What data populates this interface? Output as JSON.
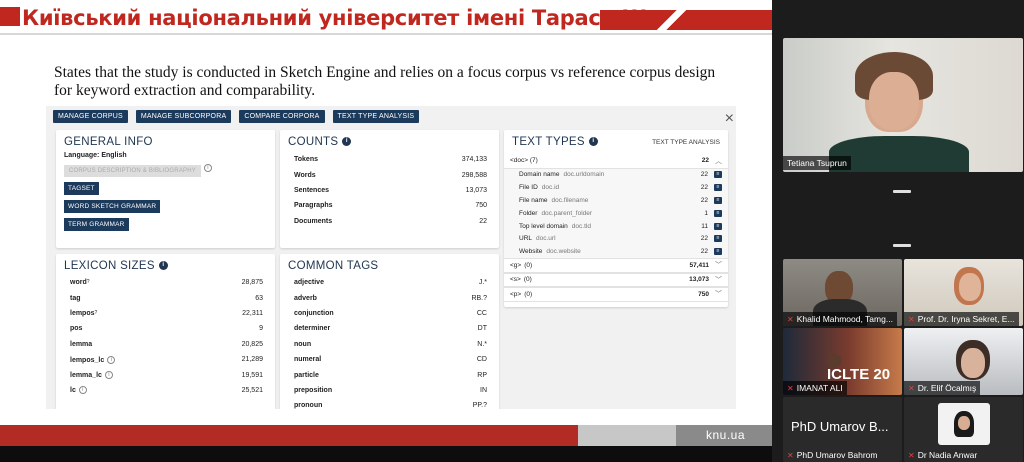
{
  "slide": {
    "title": "Київський національний університет імені Тараса Шевченка",
    "body_text": "States that the study is conducted in Sketch Engine and relies on a focus corpus vs reference corpus design for keyword extraction and comparability.",
    "footer_logo": "knu.ua"
  },
  "sketch_engine": {
    "toolbar": [
      "MANAGE CORPUS",
      "MANAGE SUBCORPORA",
      "COMPARE CORPORA",
      "TEXT TYPE ANALYSIS"
    ],
    "close_glyph": "×",
    "general_info": {
      "title": "GENERAL INFO",
      "language": "Language: English",
      "description_btn": "CORPUS DESCRIPTION & BIBLIOGRAPHY",
      "tagset_btn": "TAGSET",
      "wsg_btn": "WORD SKETCH GRAMMAR",
      "term_btn": "TERM GRAMMAR"
    },
    "counts": {
      "title": "COUNTS",
      "rows": [
        {
          "k": "Tokens",
          "v": "374,133"
        },
        {
          "k": "Words",
          "v": "298,588"
        },
        {
          "k": "Sentences",
          "v": "13,073"
        },
        {
          "k": "Paragraphs",
          "v": "750"
        },
        {
          "k": "Documents",
          "v": "22"
        }
      ]
    },
    "text_types": {
      "title": "TEXT TYPES",
      "link": "TEXT TYPE ANALYSIS",
      "doc": {
        "k": "<doc>",
        "n": "(7)",
        "v": "22"
      },
      "doc_attrs": [
        {
          "k": "Domain name",
          "a": "doc.urldomain",
          "v": "22"
        },
        {
          "k": "File ID",
          "a": "doc.id",
          "v": "22"
        },
        {
          "k": "File name",
          "a": "doc.filename",
          "v": "22"
        },
        {
          "k": "Folder",
          "a": "doc.parent_folder",
          "v": "1"
        },
        {
          "k": "Top level domain",
          "a": "doc.tld",
          "v": "11"
        },
        {
          "k": "URL",
          "a": "doc.url",
          "v": "22"
        },
        {
          "k": "Website",
          "a": "doc.website",
          "v": "22"
        }
      ],
      "structs": [
        {
          "k": "<g>",
          "n": "(0)",
          "v": "57,411"
        },
        {
          "k": "<s>",
          "n": "(0)",
          "v": "13,073"
        },
        {
          "k": "<p>",
          "n": "(0)",
          "v": "750"
        }
      ]
    },
    "lexicon": {
      "title": "LEXICON SIZES",
      "rows": [
        {
          "k": "word",
          "sup": "?",
          "v": "28,875"
        },
        {
          "k": "tag",
          "sup": "",
          "v": "63"
        },
        {
          "k": "lempos",
          "sup": "?",
          "v": "22,311"
        },
        {
          "k": "pos",
          "sup": "",
          "v": "9"
        },
        {
          "k": "lemma",
          "sup": "",
          "v": "20,825"
        },
        {
          "k": "lempos_lc",
          "sup": "i",
          "v": "21,289"
        },
        {
          "k": "lemma_lc",
          "sup": "i",
          "v": "19,591"
        },
        {
          "k": "lc",
          "sup": "i",
          "v": "25,521"
        }
      ]
    },
    "tags": {
      "title": "COMMON TAGS",
      "rows": [
        {
          "k": "adjective",
          "v": "J.*"
        },
        {
          "k": "adverb",
          "v": "RB.?"
        },
        {
          "k": "conjunction",
          "v": "CC"
        },
        {
          "k": "determiner",
          "v": "DT"
        },
        {
          "k": "noun",
          "v": "N.*"
        },
        {
          "k": "numeral",
          "v": "CD"
        },
        {
          "k": "particle",
          "v": "RP"
        },
        {
          "k": "preposition",
          "v": "IN"
        },
        {
          "k": "pronoun",
          "v": "PP.?"
        }
      ]
    }
  },
  "participants": {
    "speaker": "Tetiana Tsuprun",
    "tile1": "Khalid Mahmood, Tamg...",
    "tile2": "Prof. Dr. Iryna Sekret, E...",
    "tile3": "IMANAT ALI",
    "tile3_banner": "ICLTE 20",
    "tile4": "Dr. Elif Öcalmış",
    "tile5_big": "PhD Umarov B...",
    "tile5": "PhD Umarov Bahrom",
    "tile6": "Dr Nadia Anwar"
  },
  "colors": {
    "brand_red": "#c0281f",
    "navy": "#1b3a5c"
  }
}
